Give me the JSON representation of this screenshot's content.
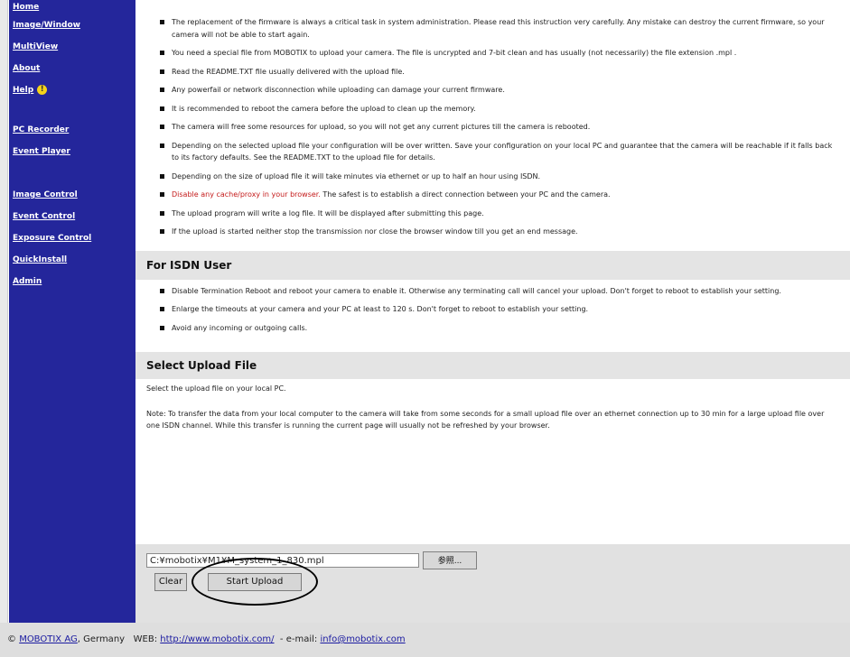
{
  "sidebar": {
    "groups": [
      [
        "Home",
        "Image/Window",
        "MultiView",
        "About",
        "Help"
      ],
      [
        "PC Recorder",
        "Event Player"
      ],
      [
        "Image Control",
        "Event Control",
        "Exposure Control",
        "QuickInstall",
        "Admin"
      ]
    ]
  },
  "bullets": [
    {
      "text": "The replacement of the firmware is always a critical task in system administration. Please read this instruction very carefully. Any mistake can destroy the current firmware, so your camera will not be able to start again."
    },
    {
      "text": "You need a special file from MOBOTIX to upload your camera. The file is uncrypted and 7-bit clean and has usually (not necessarily) the file extension .mpl ."
    },
    {
      "text": "Read the README.TXT file usually delivered with the upload file."
    },
    {
      "text": "Any powerfail or network disconnection while uploading can damage your current firmware."
    },
    {
      "text": "It is recommended to reboot the camera before the upload to clean up the memory."
    },
    {
      "text": "The camera will free some resources for upload, so you will not get any current pictures till the camera is rebooted."
    },
    {
      "text": "Depending on the selected upload file your configuration will be over written. Save your configuration on your local PC and guarantee that the camera will be reachable if it falls back to its factory defaults. See the README.TXT to the upload file for details."
    },
    {
      "text": "Depending on the size of upload file it will take minutes via ethernet or up to half an hour using ISDN."
    },
    {
      "red": "Disable any cache/proxy in your browser.",
      "text": " The safest is to establish a direct connection between your PC and the camera."
    },
    {
      "text": "The upload program will write a log file. It will be displayed after submitting this page."
    },
    {
      "text": "If the upload is started neither stop the transmission nor close the browser window till you get an end message."
    }
  ],
  "isdn": {
    "title": "For ISDN User",
    "bullets": [
      "Disable Termination Reboot and reboot your camera to enable it. Otherwise any terminating call will cancel your upload. Don't forget to reboot to establish your setting.",
      "Enlarge the timeouts at your camera and your PC at least to 120 s. Don't forget to reboot to establish your setting.",
      "Avoid any incoming or outgoing calls."
    ]
  },
  "upload": {
    "title": "Select Upload File",
    "intro": "Select the upload file on your local PC.",
    "note": "Note: To transfer the data from your local computer to the camera will take from some seconds for a small upload file over an ethernet connection up to 30 min for a large upload file over one ISDN channel. While this transfer is running the current page will usually not be refreshed by your browser.",
    "file_value": "C:¥mobotix¥M1¥M_system_1_830.mpl",
    "browse_label": "参照...",
    "clear_label": "Clear",
    "start_label": "Start Upload"
  },
  "footer": {
    "copyright": "© ",
    "company": "MOBOTIX AG",
    "country": ", Germany",
    "web_label": "WEB:",
    "web_url": "http://www.mobotix.com/",
    "email_label": "e-mail:",
    "email": "info@mobotix.com"
  },
  "colors": {
    "sidebar": "#24269b",
    "accent_red": "#c41a1a",
    "link": "#1a1aa0"
  }
}
